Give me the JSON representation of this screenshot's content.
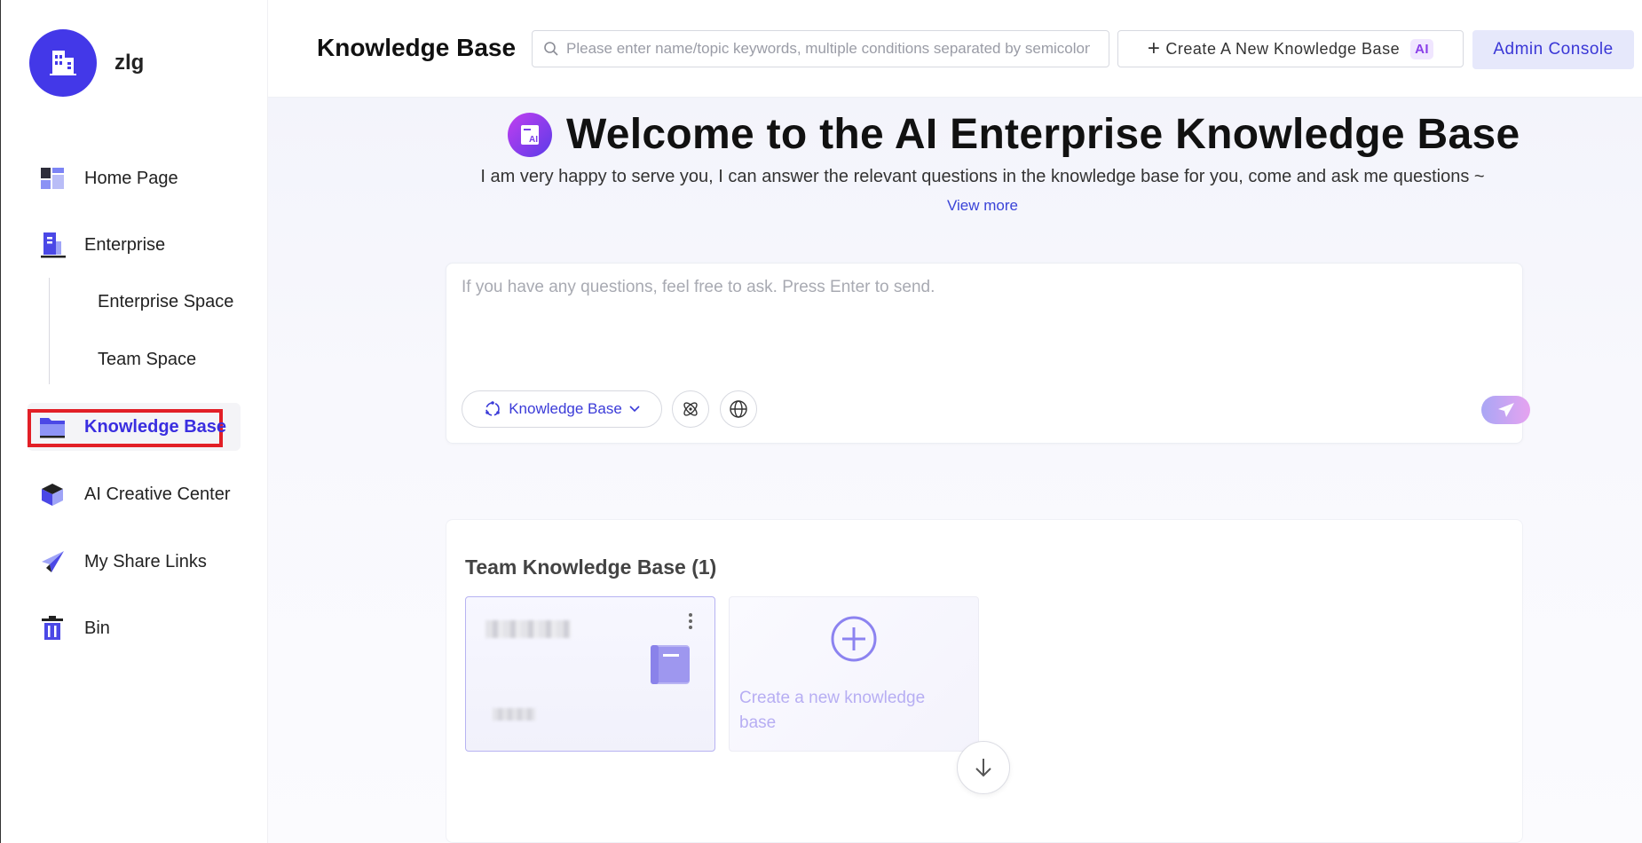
{
  "brand": {
    "name": "zlg",
    "avatar_icon": "building-icon",
    "color": "#4338e8"
  },
  "sidebar": {
    "items": [
      {
        "label": "Home Page",
        "icon": "dashboard-icon"
      },
      {
        "label": "Enterprise",
        "icon": "enterprise-building-icon"
      },
      {
        "label": "Knowledge Base",
        "icon": "folder-icon",
        "active": true
      },
      {
        "label": "AI Creative Center",
        "icon": "cube-icon"
      },
      {
        "label": "My Share Links",
        "icon": "paper-plane-icon"
      },
      {
        "label": "Bin",
        "icon": "trash-icon"
      }
    ],
    "sub_items": [
      {
        "label": "Enterprise Space"
      },
      {
        "label": "Team Space"
      }
    ]
  },
  "header": {
    "title": "Knowledge Base",
    "search_placeholder": "Please enter name/topic keywords, multiple conditions separated by semicolon",
    "create_label": "Create A New Knowledge Base",
    "create_badge": "AI",
    "admin_label": "Admin Console"
  },
  "welcome": {
    "title": "Welcome to the AI Enterprise Knowledge Base",
    "logo_text": "AI",
    "subtitle": "I am very happy to serve you, I can answer the relevant questions in the knowledge base for you, come and ask me questions ~",
    "view_more": "View more"
  },
  "chat": {
    "placeholder": "If you have any questions, feel free to ask. Press Enter to send.",
    "source_label": "Knowledge Base"
  },
  "team_kb": {
    "title": "Team Knowledge Base (1)",
    "new_label": "Create a new knowledge base"
  },
  "colors": {
    "accent": "#3a2ee0",
    "highlight_outline": "#e21f26",
    "admin_bg": "#e6e8fb"
  }
}
